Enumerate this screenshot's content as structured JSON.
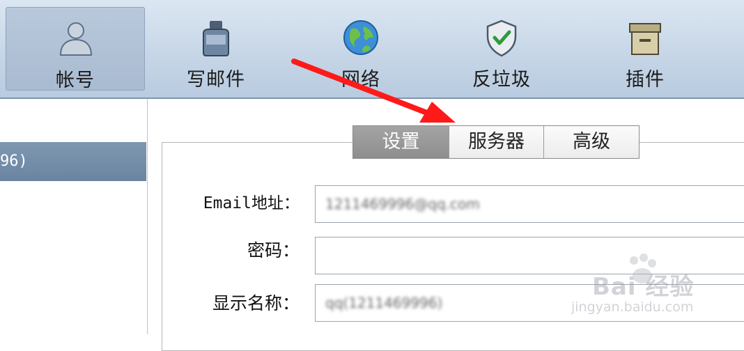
{
  "toolbar": {
    "items": [
      {
        "label": "帐号",
        "icon": "user-icon"
      },
      {
        "label": "写邮件",
        "icon": "ink-bottle-icon"
      },
      {
        "label": "网络",
        "icon": "globe-icon"
      },
      {
        "label": "反垃圾",
        "icon": "shield-check-icon"
      },
      {
        "label": "插件",
        "icon": "box-icon"
      }
    ],
    "active_index": 0
  },
  "sidebar": {
    "account_text": "96)"
  },
  "tabs": [
    {
      "label": "设置",
      "active": true
    },
    {
      "label": "服务器",
      "active": false
    },
    {
      "label": "高级",
      "active": false
    }
  ],
  "form": {
    "email_label": "Email地址：",
    "email_value": "1211469996@qq.com",
    "password_label": "密码：",
    "password_value": "",
    "display_name_label": "显示名称：",
    "display_name_value": "qq(1211469996)"
  },
  "watermark": {
    "text": "Bai  经验",
    "sub": "jingyan.baidu.com"
  },
  "colors": {
    "toolbar_bg": "#c5d5e6",
    "selected_row": "#6a84a0",
    "active_tab": "#9a9a9a",
    "arrow": "#ff1a1a"
  }
}
